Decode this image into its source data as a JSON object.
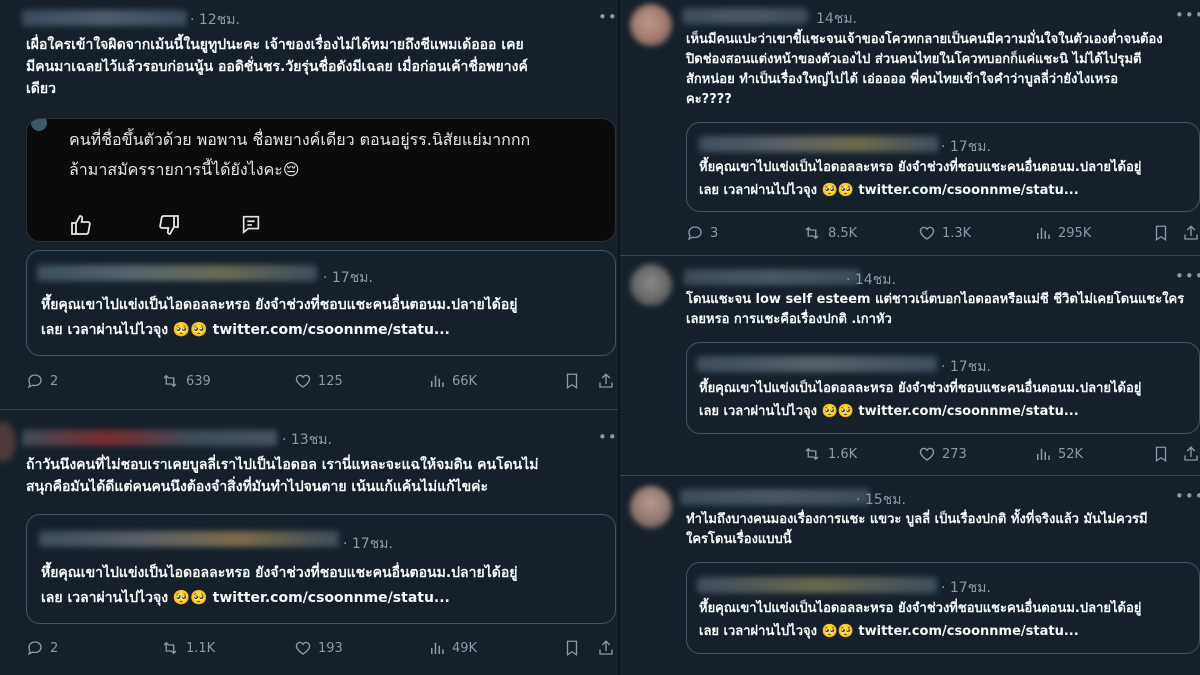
{
  "left": {
    "t1": {
      "time": "· 12ชม.",
      "text_lines": [
        "เผื่อใครเข้าใจผิดจากเม้นนี้ในยูทูปนะคะ เจ้าของเรื่องไม่ได้หมายถึงชีแพมเด้อออ เคย",
        "มีคนมาเฉลยไว้แล้วรอบก่อนนู้น ออดิชั่นชร.วัยรุ่นชื่อดังมีเฉลย เมื่อก่อนเค้าชื่อพยางค์",
        "เดียว"
      ],
      "card_lines": [
        "คนที่ชื่อขึ้นตัวด้วย พอพาน ชื่อพยางค์เดียว ตอนอยู่รร.นิสัยแย่มากกก",
        "ล้ามาสมัครรายการนี้ได้ยังไงคะ😔"
      ],
      "quote_time": "· 17ชม.",
      "quote_lines": [
        "หึ้ยคุณเขาไปแข่งเป็นไอดอลละหรอ ยังจำช่วงที่ชอบแชะคนอื่นตอนม.ปลายได้อยู่",
        "เลย เวลาผ่านไปไวจุง 🥺🥺 twitter.com/csoonnme/statu..."
      ],
      "reply": "2",
      "retweet": "639",
      "like": "125",
      "views": "66K"
    },
    "t2": {
      "time": "· 13ชม.",
      "text_lines": [
        "ถ้าวันนึงคนที่ไม่ชอบเราเคยบูลลี่เราไปเป็นไอดอล เรานี่แหละจะแฉให้จมดิน คนโดนไม่",
        "สนุกคือมันได้ดีแต่คนคนนึงต้องจำสิ่งที่มันทำไปจนตาย เน้นแก้แค้นไม่แก้ไขค่ะ"
      ],
      "quote_time": "· 17ชม.",
      "quote_lines": [
        "หึ้ยคุณเขาไปแข่งเป็นไอดอลละหรอ ยังจำช่วงที่ชอบแชะคนอื่นตอนม.ปลายได้อยู่",
        "เลย เวลาผ่านไปไวจุง 🥺🥺 twitter.com/csoonnme/statu..."
      ],
      "reply": "2",
      "retweet": "1.1K",
      "like": "193",
      "views": "49K"
    }
  },
  "right": {
    "t1": {
      "time": "14ชม.",
      "text_lines": [
        "เห็นมีคนแปะว่าเขาขี้แชะจนเจ้าของโควทกลายเป็นคนมีความมั่นใจในตัวเองต่ำจนต้อง",
        "ปิดช่องสอนแต่งหน้าของตัวเองไป ส่วนคนไทยในโควทบอกก็แค่แชะนิ ไม่ได้ไปรุมตี",
        "สักหน่อย ทำเป็นเรื่องใหญ่ไปได้ เอ่ออออ พี่คนไทยเข้าใจคำว่าบูลลี่ว่ายังไงเหรอ",
        "คะ????"
      ],
      "quote_time": "· 17ชม.",
      "quote_lines": [
        "หึ้ยคุณเขาไปแข่งเป็นไอดอลละหรอ ยังจำช่วงที่ชอบแชะคนอื่นตอนม.ปลายได้อยู่",
        "เลย เวลาผ่านไปไวจุง 🥺🥺 twitter.com/csoonnme/statu..."
      ],
      "reply": "3",
      "retweet": "8.5K",
      "like": "1.3K",
      "views": "295K"
    },
    "t2": {
      "time": "· 14ชม.",
      "text_lines": [
        "โดนแชะจน low self esteem แต่ชาวเน็ตบอกไอดอลหรือแม่ชี ชีวิตไม่เคยโดนแชะใคร",
        "เลยหรอ การแชะคือเรื่องปกติ .เกาหัว"
      ],
      "quote_time": "· 17ชม.",
      "quote_lines": [
        "หึ้ยคุณเขาไปแข่งเป็นไอดอลละหรอ ยังจำช่วงที่ชอบแชะคนอื่นตอนม.ปลายได้อยู่",
        "เลย เวลาผ่านไปไวจุง 🥺🥺 twitter.com/csoonnme/statu..."
      ],
      "retweet": "1.6K",
      "like": "273",
      "views": "52K"
    },
    "t3": {
      "time": "· 15ชม.",
      "text_lines": [
        "ทำไมถึงบางคนมองเรื่องการแชะ แขวะ บูลลี่ เป็นเรื่องปกติ ทั้งที่จริงแล้ว มันไม่ควรมี",
        "ใครโดนเรื่องแบบนี้"
      ],
      "quote_time": "· 17ชม.",
      "quote_lines": [
        "หึ้ยคุณเขาไปแข่งเป็นไอดอลละหรอ ยังจำช่วงที่ชอบแชะคนอื่นตอนม.ปลายได้อยู่",
        "เลย เวลาผ่านไปไวจุง 🥺🥺 twitter.com/csoonnme/statu..."
      ]
    }
  },
  "icons": [
    "reply-icon",
    "retweet-icon",
    "like-icon",
    "views-icon",
    "bookmark-icon",
    "share-icon",
    "more-icon",
    "thumbs-up-icon",
    "thumbs-down-icon",
    "comment-icon"
  ],
  "colors": {
    "background": "#15202b",
    "border": "#38444d",
    "secondary_text": "#8b98a5",
    "primary_text": "#f7f9f9"
  }
}
